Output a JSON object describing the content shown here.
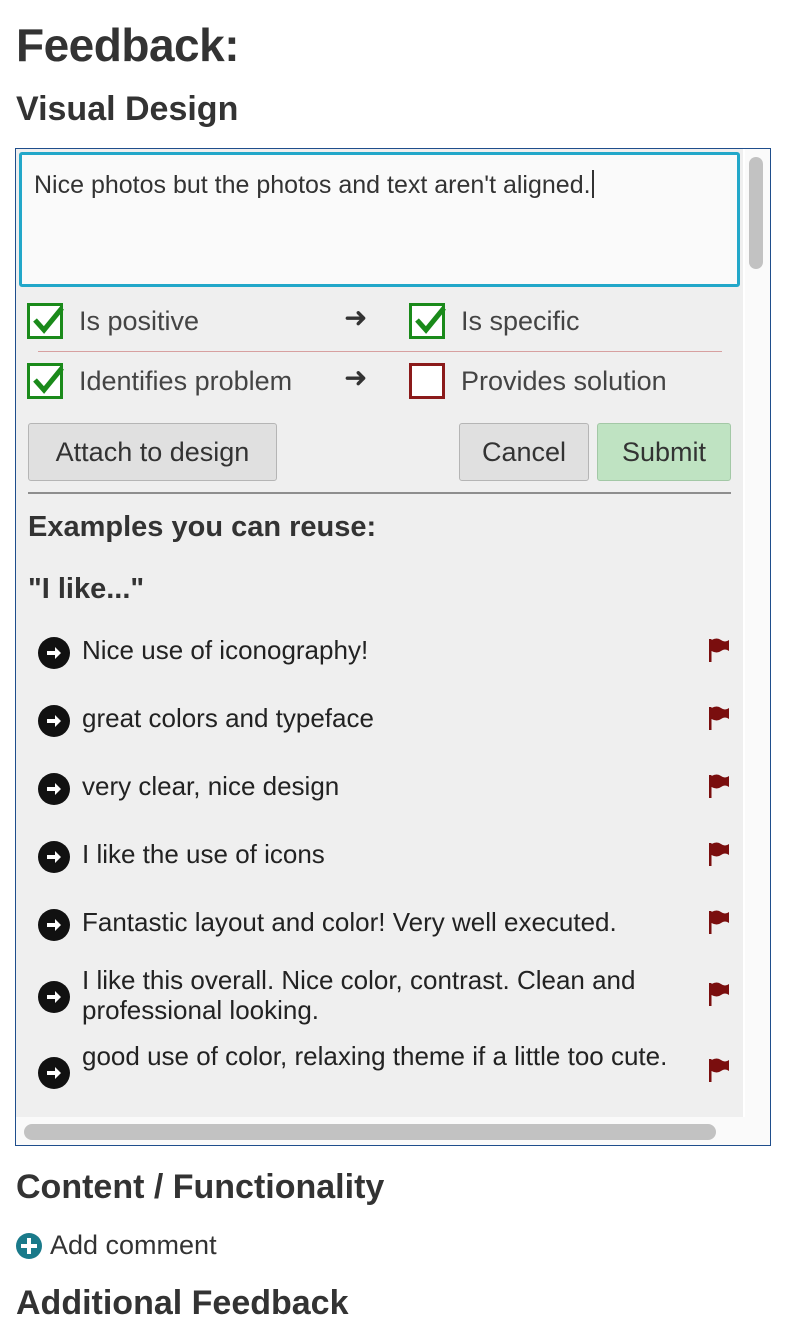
{
  "page": {
    "title": "Feedback:",
    "sections": [
      "Visual Design",
      "Content / Functionality",
      "Additional Feedback"
    ]
  },
  "comment": {
    "text": "Nice photos but the photos and text aren't aligned."
  },
  "checks": [
    {
      "label": "Is positive",
      "checked": true
    },
    {
      "label": "Is specific",
      "checked": true
    },
    {
      "label": "Identifies problem",
      "checked": true
    },
    {
      "label": "Provides solution",
      "checked": false
    }
  ],
  "buttons": {
    "attach": "Attach to design",
    "cancel": "Cancel",
    "submit": "Submit"
  },
  "examples": {
    "heading": "Examples you can reuse:",
    "group": "\"I like...\"",
    "items": [
      "Nice use of iconography!",
      "great colors and typeface",
      "very clear, nice design",
      "I like the use of icons",
      "Fantastic layout and color! Very well executed.",
      "I like this overall. Nice color, contrast. Clean and professional looking.",
      "good use of color, relaxing theme if a little too cute."
    ]
  },
  "add_comment": "Add comment",
  "colors": {
    "check_green": "#1a8a1a",
    "uncheck_red": "#8b1a1a",
    "focus_blue": "#22a7c9",
    "submit_green": "#bfe3c2",
    "flag_red": "#7a0e0e",
    "add_icon": "#1a7a8a"
  }
}
